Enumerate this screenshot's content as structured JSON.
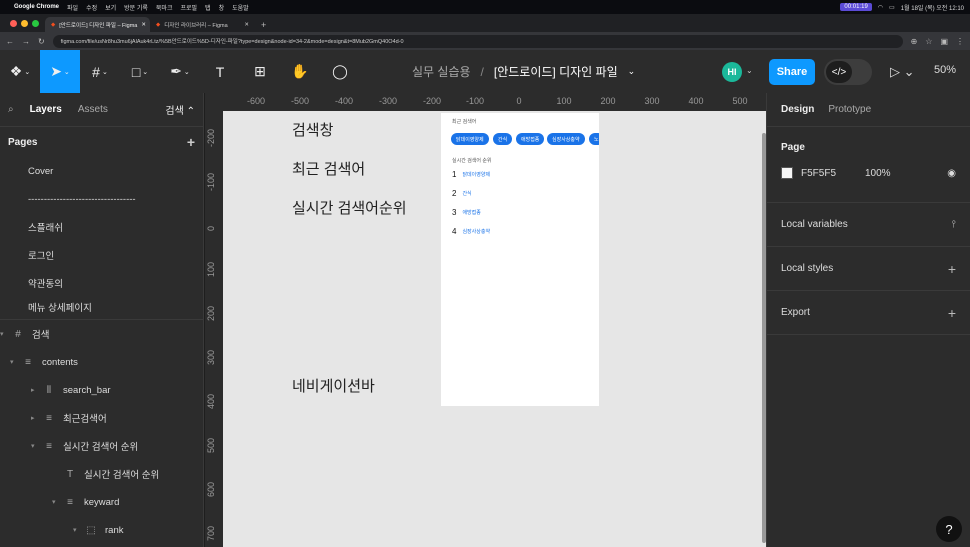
{
  "mac": {
    "app": "Google Chrome",
    "menus": [
      "파일",
      "수정",
      "보기",
      "방문 기록",
      "북마크",
      "프로필",
      "탭",
      "창",
      "도움말"
    ],
    "timer": "00:01:19",
    "clock": "1월 18일 (목) 오전 12:10"
  },
  "browser": {
    "tabs": [
      {
        "title": "[안드로이드] 디자인 파일 – Figma",
        "active": true
      },
      {
        "title": "디자인 라이브러리 – Figma",
        "active": false
      }
    ],
    "url": "figma.com/file/usNr8hu3mu6jAlAuk4rLtz/%5B안드로이드%5D-디자인-파일?type=design&node-id=34-2&mode=design&t=8Mub2GmQ40O4d-0"
  },
  "toolbar": {
    "project": "실무 실습용",
    "sep": "/",
    "file": "[안드로이드] 디자인 파일",
    "avatar": "HI",
    "share": "Share",
    "zoom": "50%"
  },
  "left": {
    "tab_layers": "Layers",
    "tab_assets": "Assets",
    "current_page": "검색",
    "pages_title": "Pages",
    "pages": [
      "Cover",
      "----------------------------------",
      "스플래쉬",
      "로그인",
      "약관동의",
      "메뉴 상세페이지"
    ],
    "layers": [
      {
        "name": "검색",
        "icon": "#",
        "indent": 0,
        "caret": "▾"
      },
      {
        "name": "contents",
        "icon": "≡",
        "indent": 1,
        "caret": "▾"
      },
      {
        "name": "search_bar",
        "icon": "⦀",
        "indent": 2,
        "caret": "▸"
      },
      {
        "name": "최근검색어",
        "icon": "≡",
        "indent": 2,
        "caret": "▸"
      },
      {
        "name": "실시간 검색어 순위",
        "icon": "≡",
        "indent": 2,
        "caret": "▾"
      },
      {
        "name": "실시간 검색어 순위",
        "icon": "T",
        "indent": 3,
        "caret": ""
      },
      {
        "name": "keyward",
        "icon": "≡",
        "indent": 3,
        "caret": "▾"
      },
      {
        "name": "rank",
        "icon": "⬚",
        "indent": 4,
        "caret": "▾"
      }
    ]
  },
  "canvas": {
    "ruler_x": [
      "-600",
      "-500",
      "-400",
      "-300",
      "-200",
      "-100",
      "0",
      "100",
      "200",
      "300",
      "400",
      "500"
    ],
    "ruler_y": [
      "-200",
      "-100",
      "0",
      "100",
      "200",
      "300",
      "400",
      "500",
      "600",
      "700"
    ],
    "labels": [
      "검색창",
      "최근 검색어",
      "실시간 검색어순위",
      "네비게이션바"
    ],
    "frame": {
      "recent_title": "최근 검색어",
      "chips": [
        "닭데이영양제",
        "간식",
        "애방접종",
        "심장사상충약",
        "노"
      ],
      "realtime_title": "실시간 검색어 순위",
      "ranks": [
        {
          "n": "1",
          "name": "닭데이영양제"
        },
        {
          "n": "2",
          "name": "간식"
        },
        {
          "n": "3",
          "name": "애방접종"
        },
        {
          "n": "4",
          "name": "심장사상충약"
        }
      ]
    }
  },
  "right": {
    "tab_design": "Design",
    "tab_prototype": "Prototype",
    "page_title": "Page",
    "page_color": "F5F5F5",
    "page_opacity": "100%",
    "local_variables": "Local variables",
    "local_styles": "Local styles",
    "export": "Export"
  },
  "help": "?"
}
